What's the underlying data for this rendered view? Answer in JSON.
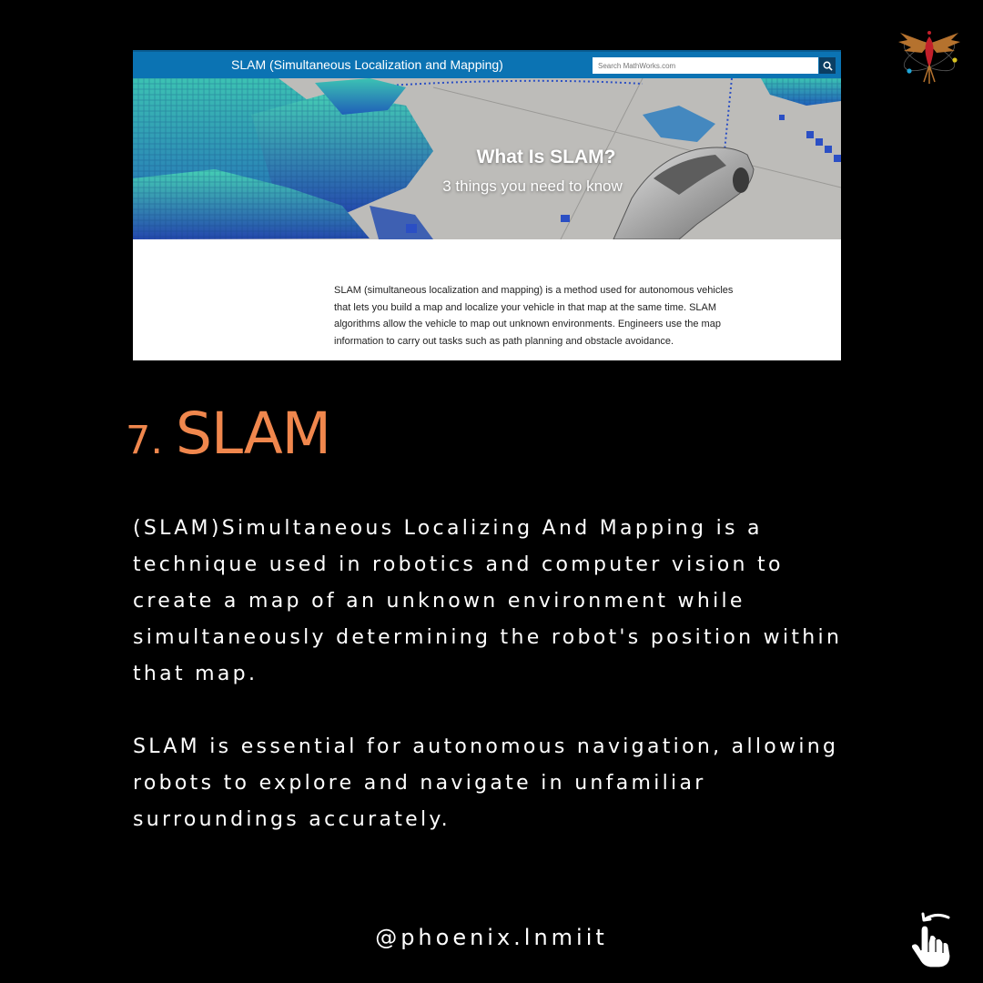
{
  "screenshot": {
    "header_title": "SLAM (Simultaneous Localization and Mapping)",
    "search_placeholder": "Search MathWorks.com",
    "search_icon": "search-icon",
    "hero_title": "What Is SLAM?",
    "hero_subtitle": "3 things you need to know",
    "body_text": "SLAM (simultaneous localization and mapping) is a method used for autonomous vehicles that lets you build a map and localize your vehicle in that map at the same time. SLAM algorithms allow the vehicle to map out unknown environments. Engineers use the map information to carry out tasks such as path planning and obstacle avoidance.",
    "colors": {
      "header_bg": "#0b73b3",
      "search_button_bg": "#0b3e63"
    }
  },
  "slide": {
    "heading_number": "7.",
    "heading_text": "SLAM",
    "paragraph_1": "(SLAM)Simultaneous Localizing And Mapping is a technique used in robotics and computer vision to create a map of an unknown environment while simultaneously determining the robot's position within that map.",
    "paragraph_2": "SLAM is essential for autonomous navigation, allowing robots to explore and navigate in unfamiliar surroundings accurately.",
    "handle": "@phoenix.lnmiit",
    "logo_icon": "phoenix-logo-icon",
    "swipe_icon": "swipe-hand-icon",
    "colors": {
      "background": "#000000",
      "accent": "#f0874d",
      "text": "#ffffff"
    }
  }
}
